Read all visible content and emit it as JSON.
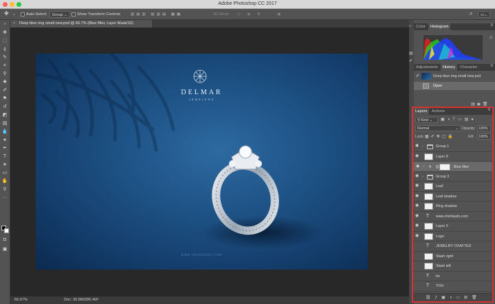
{
  "app": {
    "title": "Adobe Photoshop CC 2017"
  },
  "options_bar": {
    "auto_select_label": "Auto-Select:",
    "auto_select_value": "Group",
    "transform_label": "Show Transform Controls",
    "mode_3d": "3D Mode:"
  },
  "document": {
    "tab_label": "Deep blue ring small new.psd @ 66.7% (Blue filter, Layer Mask/16)"
  },
  "canvas": {
    "brand_name": "DELMAR",
    "brand_sub": "JEWELERS",
    "watermark": "www.chimkudo.com"
  },
  "status": {
    "zoom": "66.67%",
    "doc": "Doc: 30.8M/286.4M"
  },
  "panels": {
    "color_tabs": [
      "Color",
      "Histogram"
    ],
    "history_tabs": [
      "Adjustments",
      "History",
      "Character"
    ],
    "history_items": [
      "Deep blue ring small new.psd",
      "Open"
    ],
    "layers_tabs": [
      "Layers",
      "Actions"
    ],
    "kind": "Kind",
    "blend_mode": "Normal",
    "opacity_label": "Opacity:",
    "opacity": "100%",
    "lock_label": "Lock:",
    "fill_label": "Fill:",
    "fill": "100%"
  },
  "layers": [
    {
      "name": "Group 1",
      "type": "group"
    },
    {
      "name": "Layer 8",
      "type": "pixel"
    },
    {
      "name": "Blue filter",
      "type": "adjust",
      "selected": true
    },
    {
      "name": "Group 3",
      "type": "group"
    },
    {
      "name": "Leaf",
      "type": "pixel"
    },
    {
      "name": "Leaf shadow",
      "type": "pixel"
    },
    {
      "name": "Ring shadow",
      "type": "pixel"
    },
    {
      "name": "www.chimkudo.com",
      "type": "text"
    },
    {
      "name": "Layer 5",
      "type": "pixel"
    },
    {
      "name": "Logo",
      "type": "pixel"
    },
    {
      "name": "JEWELRY CRAFTED",
      "type": "text"
    },
    {
      "name": "Slash right",
      "type": "pixel"
    },
    {
      "name": "Slash left",
      "type": "pixel"
    },
    {
      "name": "for",
      "type": "text"
    },
    {
      "name": "YOU",
      "type": "text"
    }
  ]
}
